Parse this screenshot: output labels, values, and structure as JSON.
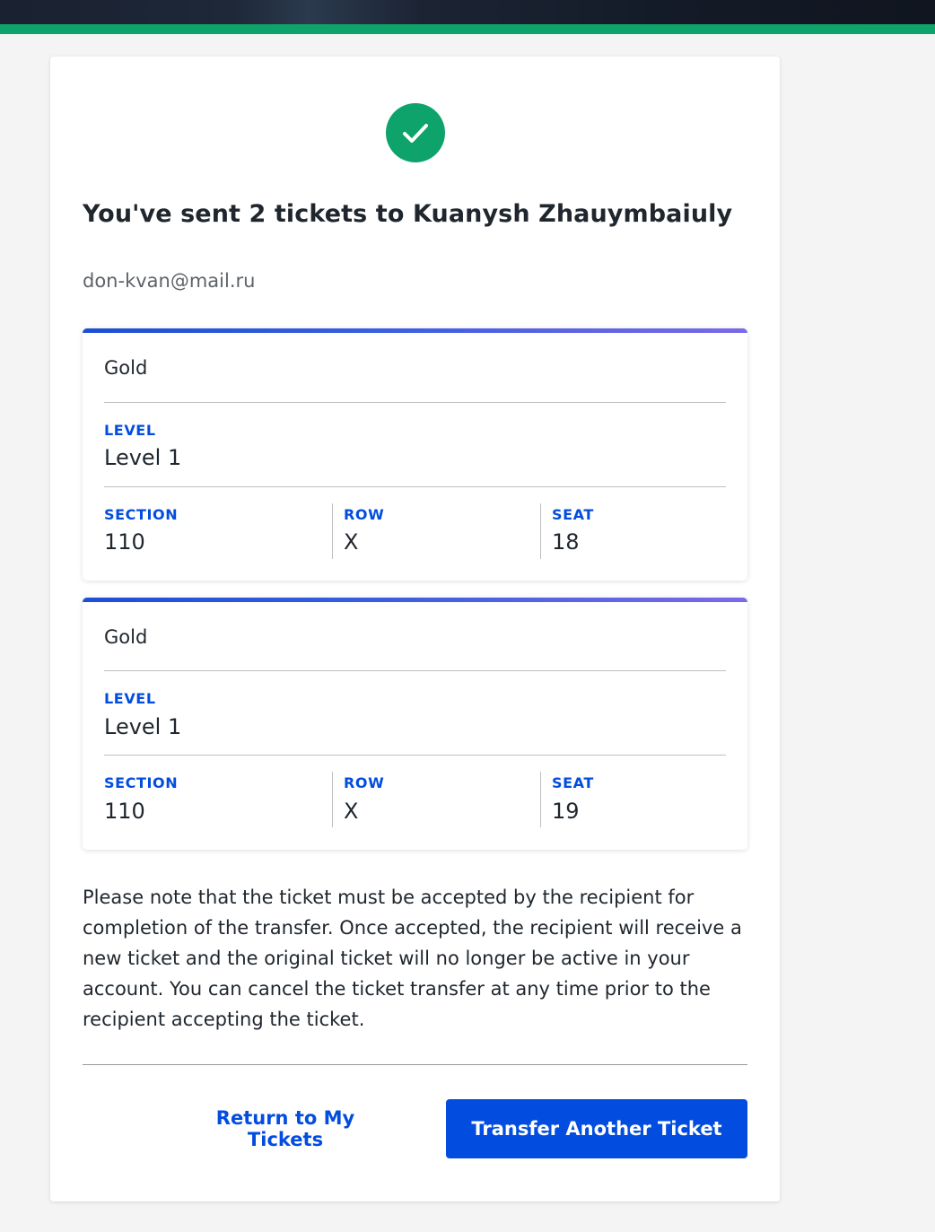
{
  "colors": {
    "success_green": "#0ea36b",
    "brand_blue": "#024ddf",
    "header_dark": "#1a2131"
  },
  "icons": {
    "success": "checkmark-icon"
  },
  "confirmation": {
    "title": "You've sent 2 tickets to Kuanysh Zhauymbaiuly",
    "email": "don-kvan@mail.ru"
  },
  "tickets": [
    {
      "type": "Gold",
      "level_label": "LEVEL",
      "level_value": "Level 1",
      "section_label": "SECTION",
      "section_value": "110",
      "row_label": "ROW",
      "row_value": "X",
      "seat_label": "SEAT",
      "seat_value": "18"
    },
    {
      "type": "Gold",
      "level_label": "LEVEL",
      "level_value": "Level 1",
      "section_label": "SECTION",
      "section_value": "110",
      "row_label": "ROW",
      "row_value": "X",
      "seat_label": "SEAT",
      "seat_value": "19"
    }
  ],
  "note": "Please note that the ticket must be accepted by the recipient for completion of the transfer. Once accepted, the recipient will receive a new ticket and the original ticket will no longer be active in your account. You can cancel the ticket transfer at any time prior to the recipient accepting the ticket.",
  "actions": {
    "return_label": "Return to My Tickets",
    "transfer_label": "Transfer Another Ticket"
  }
}
